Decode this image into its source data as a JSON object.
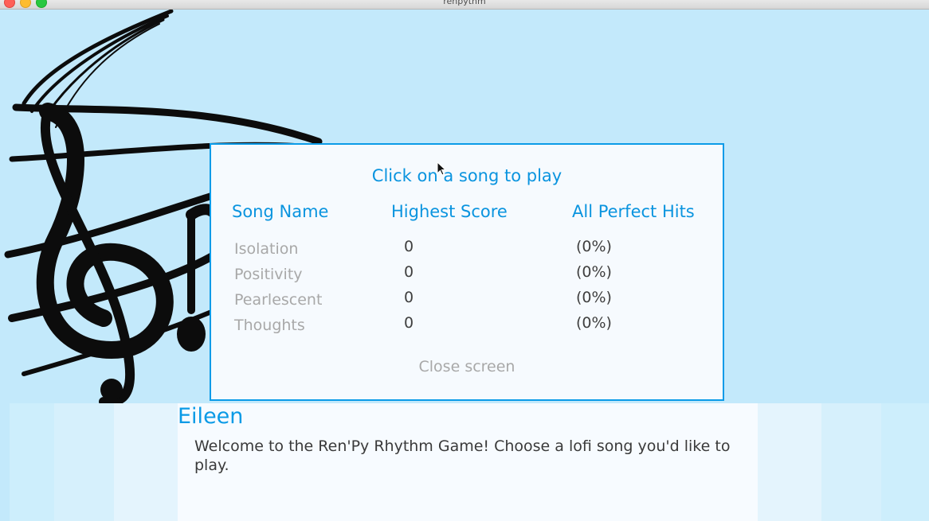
{
  "window": {
    "title": "renpythm"
  },
  "modal": {
    "title": "Click on a song to play",
    "headers": {
      "song_name": "Song Name",
      "highest_score": "Highest Score",
      "all_perfect": "All Perfect Hits"
    },
    "songs": [
      {
        "name": "Isolation",
        "score": "0",
        "perfect": "(0%)"
      },
      {
        "name": "Positivity",
        "score": "0",
        "perfect": "(0%)"
      },
      {
        "name": "Pearlescent",
        "score": "0",
        "perfect": "(0%)"
      },
      {
        "name": "Thoughts",
        "score": "0",
        "perfect": "(0%)"
      }
    ],
    "close_label": "Close screen"
  },
  "dialogue": {
    "speaker": "Eileen",
    "text": "Welcome to the Ren'Py Rhythm Game! Choose a lofi song you'd like to play."
  },
  "colors": {
    "background": "#c3e9fb",
    "accent": "#0a94df",
    "muted_text": "#a8a8a8"
  }
}
